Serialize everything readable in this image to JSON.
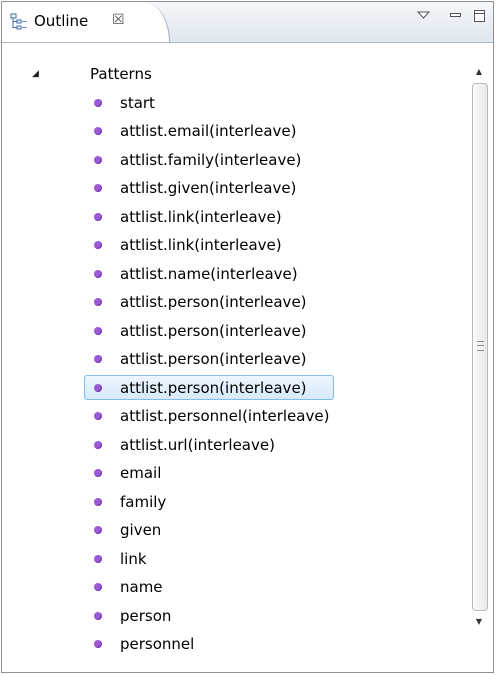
{
  "view": {
    "title": "Outline",
    "close_glyph": "☒",
    "icons": {
      "tab": "outline-view-icon",
      "view_menu": "view-menu-icon",
      "minimize": "minimize-icon",
      "maximize": "maximize-icon"
    }
  },
  "tree": {
    "root": {
      "label": "Patterns",
      "expanded": true,
      "twisty": "◢"
    },
    "items": [
      "start",
      "attlist.email(interleave)",
      "attlist.family(interleave)",
      "attlist.given(interleave)",
      "attlist.link(interleave)",
      "attlist.link(interleave)",
      "attlist.name(interleave)",
      "attlist.person(interleave)",
      "attlist.person(interleave)",
      "attlist.person(interleave)",
      "attlist.person(interleave)",
      "attlist.personnel(interleave)",
      "attlist.url(interleave)",
      "email",
      "family",
      "given",
      "link",
      "name",
      "person",
      "personnel"
    ],
    "selected_index": 10
  },
  "colors": {
    "item_bullet": "#9b5bd6",
    "selection_border": "#84bce8",
    "selection_fill": "#d7eafb"
  },
  "scrollbar": {
    "up_arrow": "▲",
    "down_arrow": "▼"
  }
}
